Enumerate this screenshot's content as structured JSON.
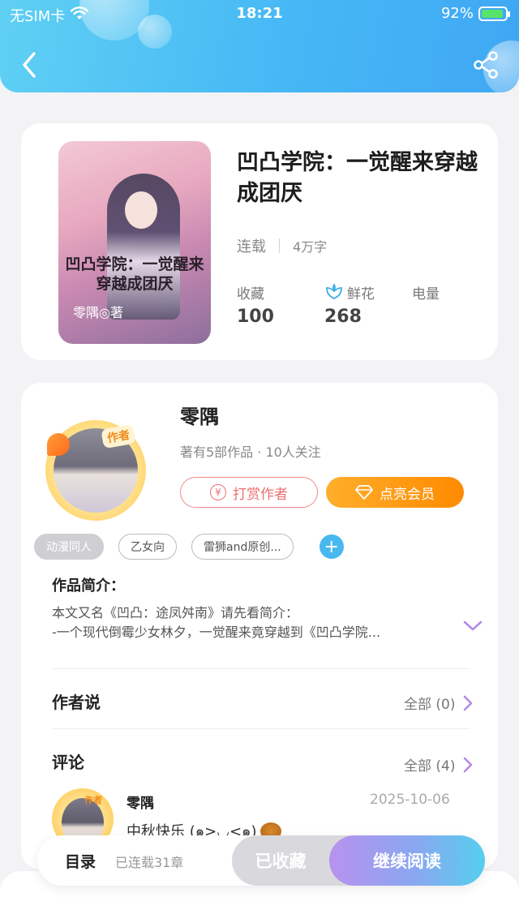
{
  "status_bar": {
    "carrier": "无SIM卡",
    "time": "18:21",
    "battery": "92%",
    "battery_level": 0.92
  },
  "book": {
    "title": "凹凸学院：一觉醒来穿越成团厌",
    "status": "连载",
    "words": "4万字",
    "cover_title": "凹凸学院：一觉醒来穿越成团厌",
    "cover_author": "零隅◎著",
    "stats": {
      "favorites_label": "收藏",
      "favorites_value": "100",
      "flowers_label": "鲜花",
      "flowers_value": "268",
      "power_label": "电量"
    }
  },
  "author": {
    "name": "零隅",
    "badge": "作者",
    "info": "著有5部作品 · 10人关注",
    "tip_button": "打赏作者",
    "vip_button": "点亮会员",
    "tags": [
      "动漫同人",
      "乙女向",
      "雷狮and原创..."
    ]
  },
  "intro": {
    "title": "作品简介：",
    "line1": "本文又名《凹凸：途凤舛南》请先看简介：",
    "line2": "-一个现代倒霉少女林夕，一觉醒来竟穿越到《凹凸学院..."
  },
  "author_says": {
    "title": "作者说",
    "all": "全部 (0)"
  },
  "comments": {
    "title": "评论",
    "all": "全部 (4)",
    "items": [
      {
        "name": "零隅",
        "date": "2025-10-06",
        "text": "中秋快乐 (๑>◡<๑)",
        "badge": "作者"
      }
    ]
  },
  "bottom": {
    "toc": "目录",
    "chapters": "已连载31章",
    "favorited": "已收藏",
    "continue": "继续阅读"
  },
  "colors": {
    "accent_blue": "#46b8f5",
    "vip_orange": "#ff8a00",
    "tip_red": "#ee6f6f"
  }
}
